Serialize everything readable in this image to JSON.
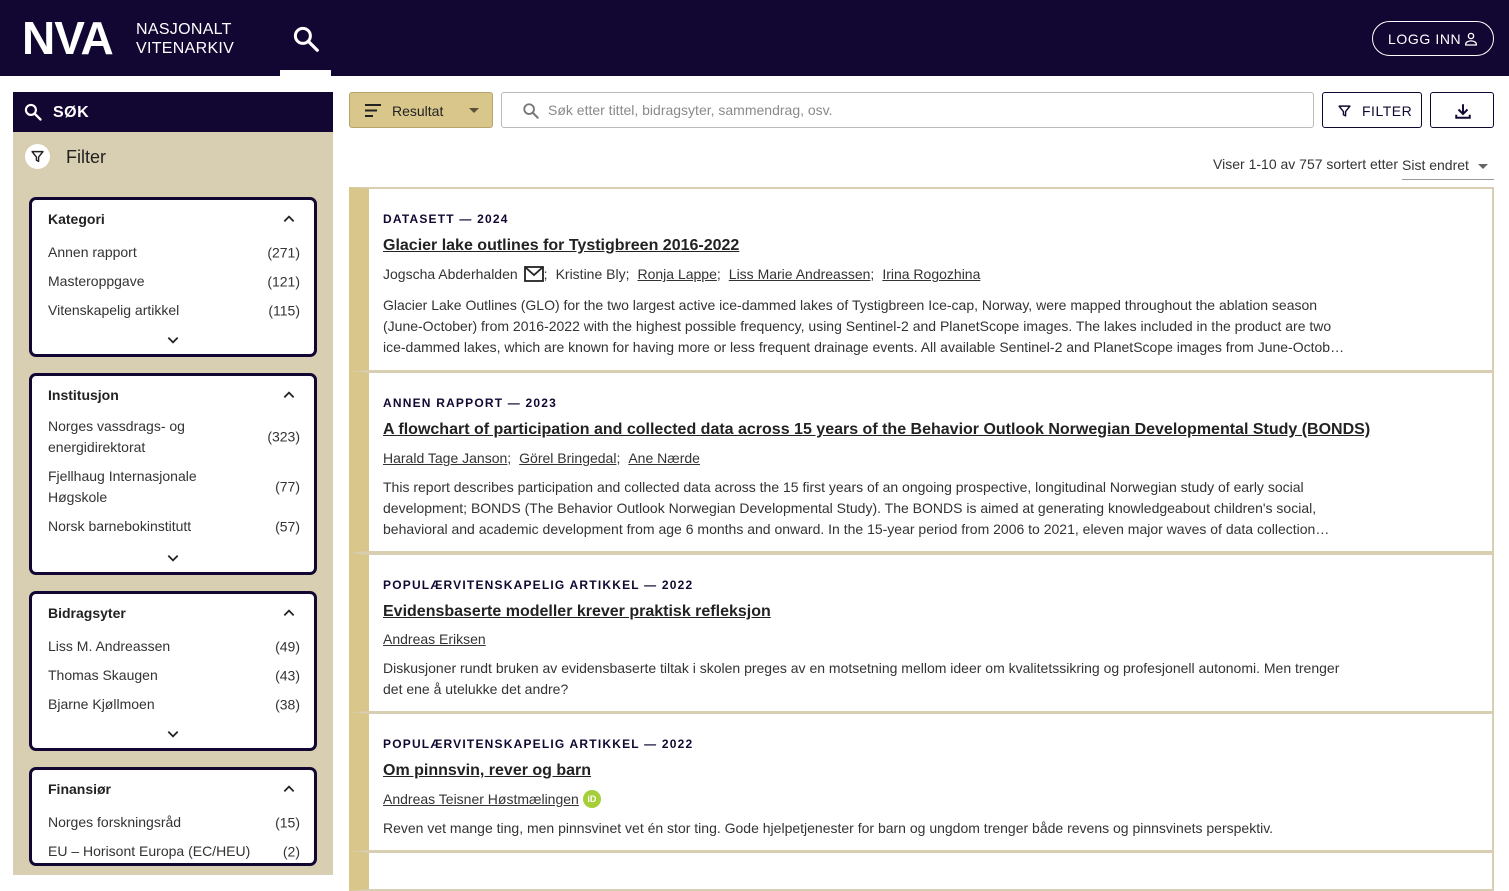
{
  "header": {
    "logo": "NVA",
    "logo_line1": "NASJONALT",
    "logo_line2": "VITENARKIV",
    "login_label": "LOGG INN"
  },
  "sidebar": {
    "title": "SØK",
    "filter_label": "Filter",
    "facets": [
      {
        "title": "Kategori",
        "items": [
          {
            "name": "Annen rapport",
            "count": "(271)"
          },
          {
            "name": "Masteroppgave",
            "count": "(121)"
          },
          {
            "name": "Vitenskapelig artikkel",
            "count": "(115)"
          }
        ]
      },
      {
        "title": "Institusjon",
        "items": [
          {
            "name": "Norges vassdrags- og energidirektorat",
            "count": "(323)"
          },
          {
            "name": "Fjellhaug Internasjonale Høgskole",
            "count": "(77)"
          },
          {
            "name": "Norsk barnebokinstitutt",
            "count": "(57)"
          }
        ]
      },
      {
        "title": "Bidragsyter",
        "items": [
          {
            "name": "Liss M. Andreassen",
            "count": "(49)"
          },
          {
            "name": "Thomas Skaugen",
            "count": "(43)"
          },
          {
            "name": "Bjarne Kjøllmoen",
            "count": "(38)"
          }
        ]
      },
      {
        "title": "Finansiør",
        "items": [
          {
            "name": "Norges forskningsråd",
            "count": "(15)"
          },
          {
            "name": "EU – Horisont Europa (EC/HEU)",
            "count": "(2)"
          }
        ]
      }
    ]
  },
  "toolbar": {
    "result_select": "Resultat",
    "search_placeholder": "Søk etter tittel, bidragsyter, sammendrag, osv.",
    "search_value": "",
    "filter_label": "FILTER"
  },
  "sort": {
    "info": "Viser 1-10 av 757 sortert etter",
    "selected": "Sist endret"
  },
  "results": [
    {
      "type": "DATASETT — 2024",
      "title": "Glacier lake outlines for Tystigbreen 2016-2022",
      "authors": [
        "Jogscha Abderhalden",
        "Kristine Bly",
        "Ronja Lappe",
        "Liss Marie Andreassen",
        "Irina Rogozhina"
      ],
      "abstract": "Glacier Lake Outlines (GLO) for the two largest active ice-dammed lakes of Tystigbreen Ice-cap, Norway, were mapped throughout the ablation season (June-October) from 2016-2022 with the highest possible frequency, using Sentinel-2 and PlanetScope images. The lakes included in the product are two ice-dammed lakes, which are known for having more or less frequent drainage events. All available Sentinel-2 and PlanetScope images from June-October were used."
    },
    {
      "type": "ANNEN RAPPORT — 2023",
      "title": "A flowchart of participation and collected data across 15 years of the Behavior Outlook Norwegian Developmental Study (BONDS)",
      "authors": [
        "Harald Tage Janson",
        "Görel Bringedal",
        "Ane Nærde"
      ],
      "abstract": "This report describes participation and collected data across the 15 first years of an ongoing prospective, longitudinal Norwegian study of early social development; BONDS (The Behavior Outlook Norwegian Developmental Study). The BONDS is aimed at generating knowledgeabout children's social, behavioral and academic development from age 6 months and onward. In the 15-year period from 2006 to 2021, eleven major waves of data collection have been carried out."
    },
    {
      "type": "POPULÆRVITENSKAPELIG ARTIKKEL — 2022",
      "title": "Evidensbaserte modeller krever praktisk refleksjon",
      "authors": [
        "Andreas Eriksen"
      ],
      "abstract": "Diskusjoner rundt bruken av evidensbaserte tiltak i skolen preges av en motsetning mellom ideer om kvalitetssikring og profesjonell autonomi. Men trenger det ene å utelukke det andre?"
    },
    {
      "type": "POPULÆRVITENSKAPELIG ARTIKKEL — 2022",
      "title": "Om pinnsvin, rever og barn",
      "authors": [
        "Andreas Teisner Høstmælingen"
      ],
      "orcid_label": "iD",
      "abstract": "Reven vet mange ting, men pinnsvinet vet én stor ting. Gode hjelpetjenester for barn og ungdom trenger både revens og pinnsvinets perspektiv."
    }
  ]
}
